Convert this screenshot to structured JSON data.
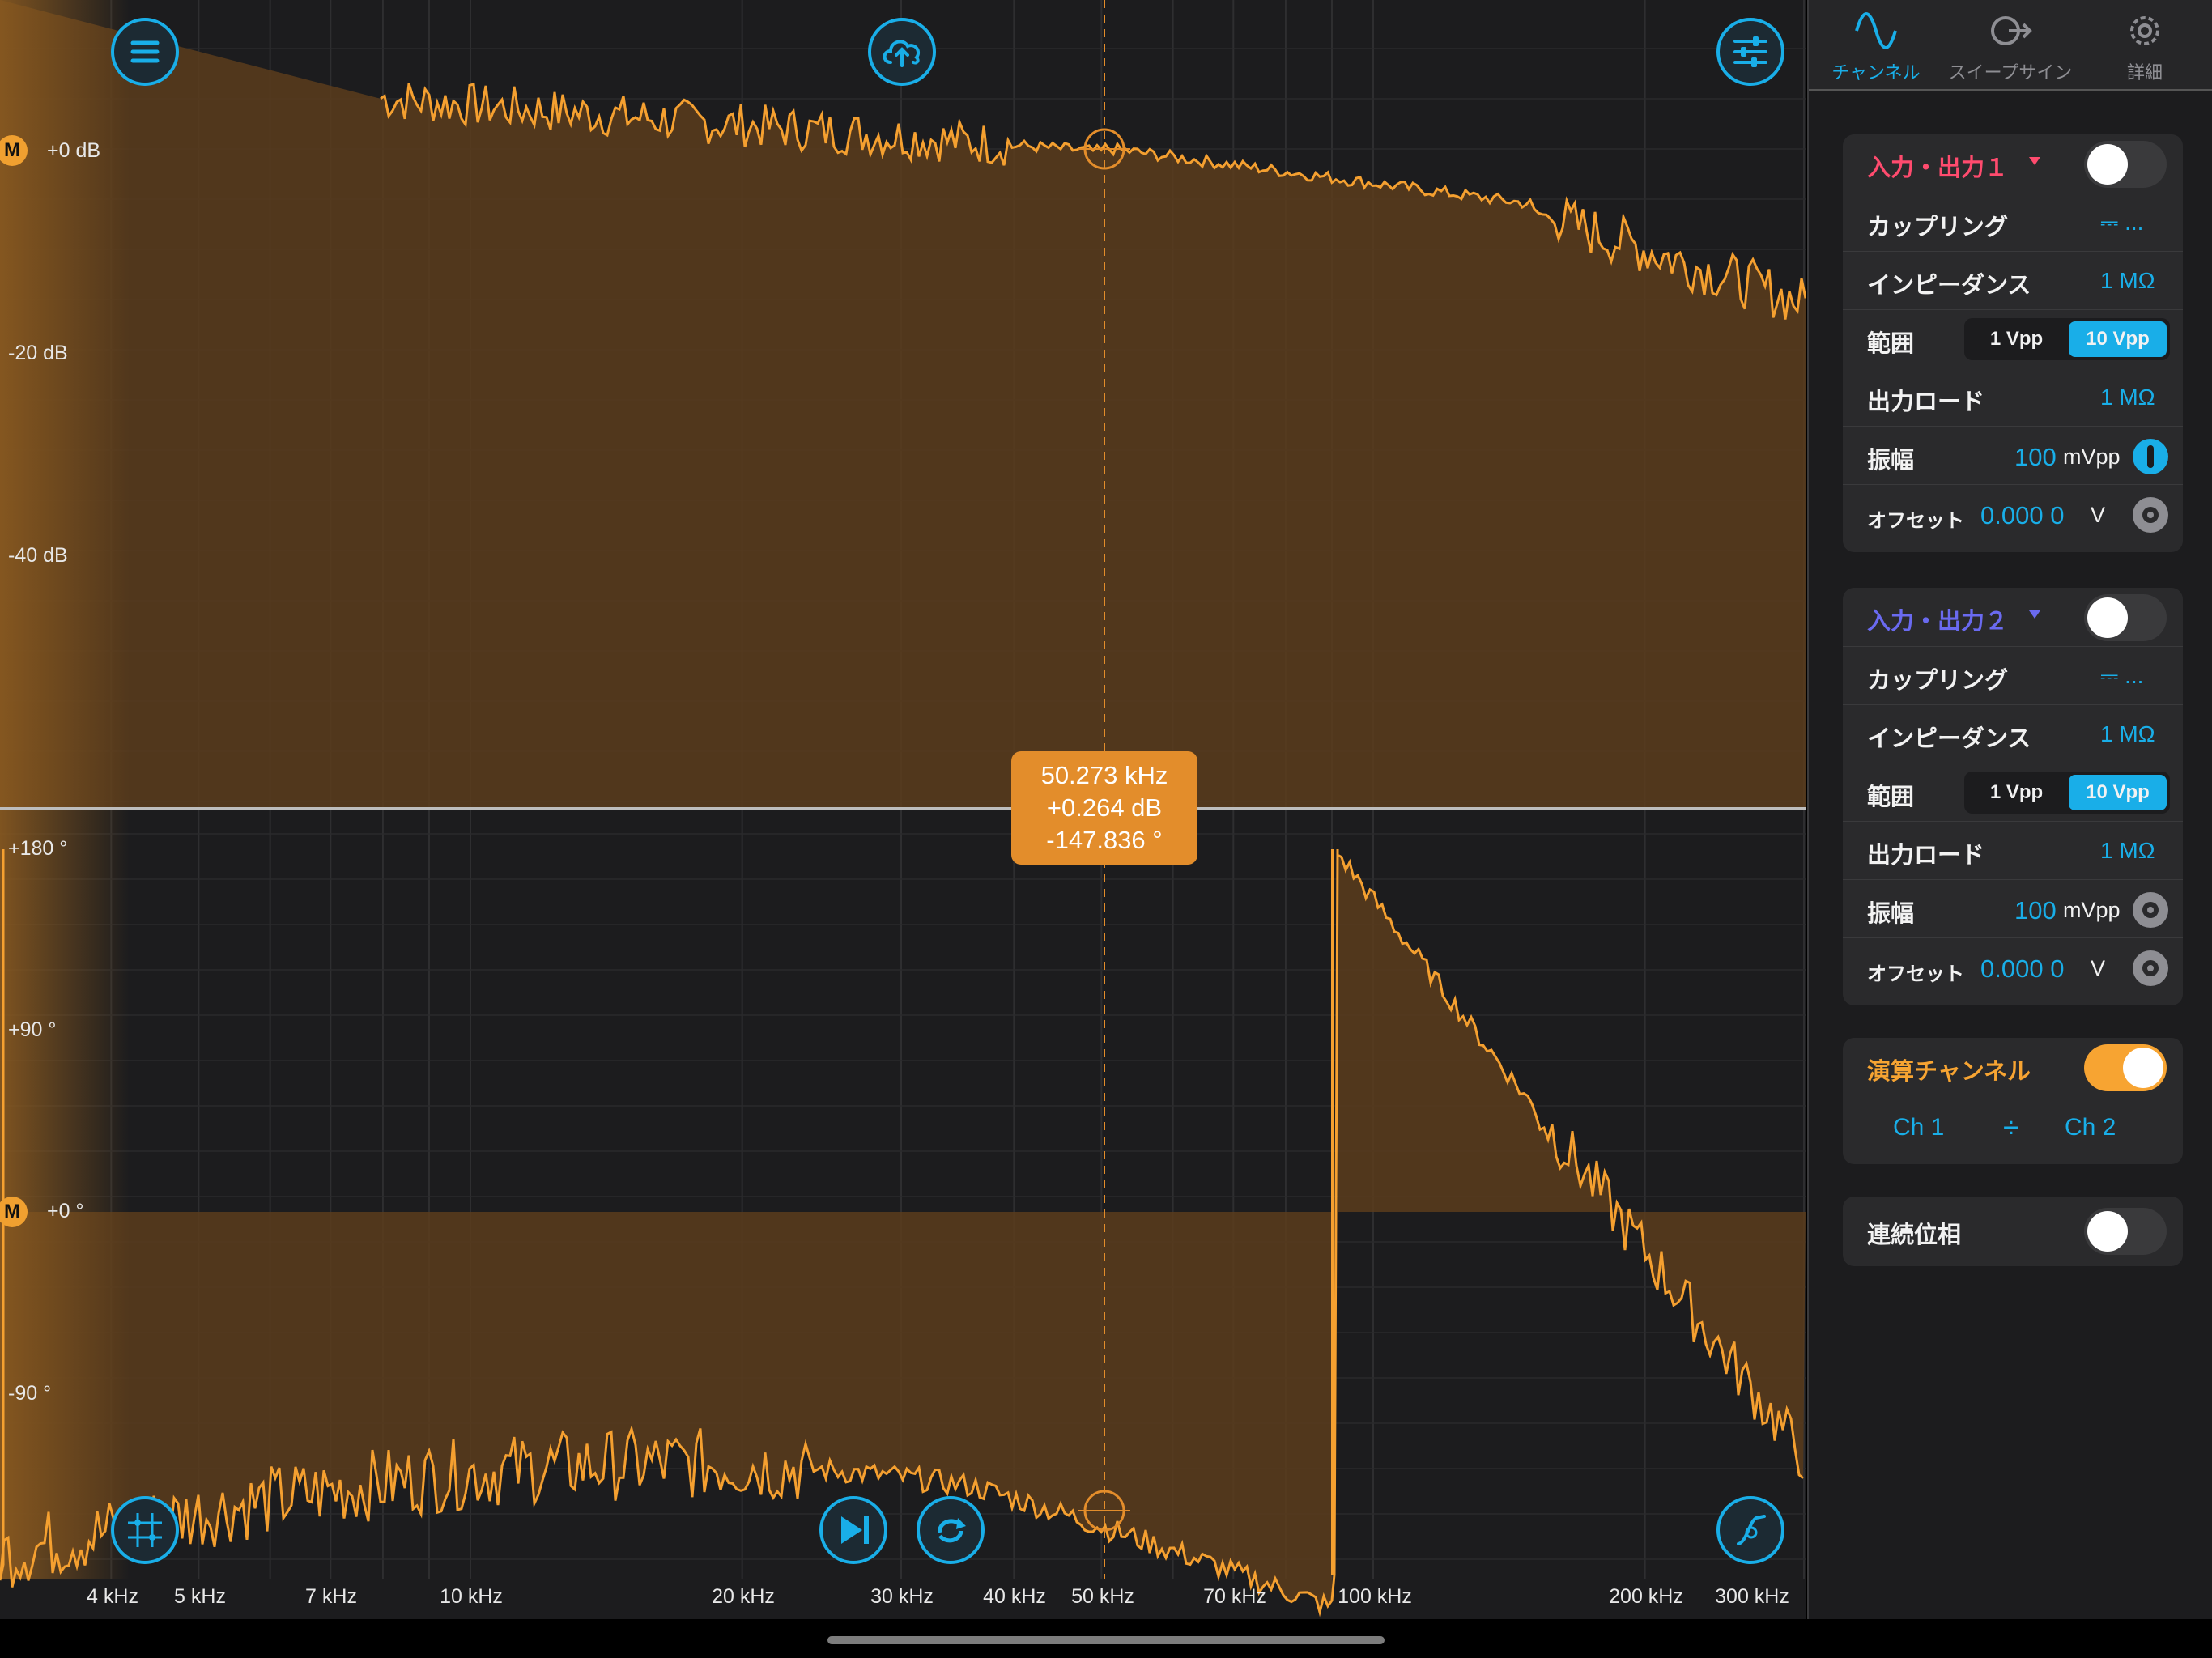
{
  "colors": {
    "accent": "#19aee8",
    "trace": "#f5a030",
    "fill": "#6b4620",
    "ch1": "#ff4b6e",
    "ch2": "#6a6af0",
    "math": "#f7a432"
  },
  "plot": {
    "magnitude_ticks": [
      "+0 dB",
      "-20 dB",
      "-40 dB"
    ],
    "phase_ticks": [
      "+180 °",
      "+90 °",
      "+0 °",
      "-90 °"
    ],
    "marker_label": "M",
    "freq_ticks": [
      "4 kHz",
      "5 kHz",
      "7 kHz",
      "10 kHz",
      "20 kHz",
      "30 kHz",
      "40 kHz",
      "50 kHz",
      "70 kHz",
      "100 kHz",
      "200 kHz",
      "300 kHz"
    ],
    "cursor": {
      "freq": "50.273 kHz",
      "gain": "+0.264 dB",
      "phase": "-147.836 °"
    }
  },
  "toolbar": {
    "menu_icon": "hamburger-menu-icon",
    "cloud_icon": "cloud-upload-icon",
    "settings_icon": "sliders-icon",
    "grid_icon": "grid-icon",
    "step_icon": "skip-forward-icon",
    "loop_icon": "repeat-icon",
    "trigger_icon": "trigger-icon"
  },
  "sidebar": {
    "tabs": [
      {
        "label": "チャンネル",
        "icon": "sine-wave-icon",
        "active": true
      },
      {
        "label": "スイープサイン",
        "icon": "sweep-icon",
        "active": false
      },
      {
        "label": "詳細",
        "icon": "gear-icon",
        "active": false
      }
    ],
    "ch1": {
      "title": "入力・出力１",
      "on": false,
      "coupling_label": "カップリング",
      "coupling_value": "⎓ ...",
      "impedance_label": "インピーダンス",
      "impedance_value": "1 MΩ",
      "range_label": "範囲",
      "range_options": [
        "1 Vpp",
        "10 Vpp"
      ],
      "range_selected": "10 Vpp",
      "load_label": "出力ロード",
      "load_value": "1 MΩ",
      "amp_label": "振幅",
      "amp_value": "100",
      "amp_unit": "mVpp",
      "offset_label": "オフセット",
      "offset_value": "0.000 0",
      "offset_unit": "V"
    },
    "ch2": {
      "title": "入力・出力２",
      "on": false,
      "coupling_label": "カップリング",
      "coupling_value": "⎓ ...",
      "impedance_label": "インピーダンス",
      "impedance_value": "1 MΩ",
      "range_label": "範囲",
      "range_options": [
        "1 Vpp",
        "10 Vpp"
      ],
      "range_selected": "10 Vpp",
      "load_label": "出力ロード",
      "load_value": "1 MΩ",
      "amp_label": "振幅",
      "amp_value": "100",
      "amp_unit": "mVpp",
      "offset_label": "オフセット",
      "offset_value": "0.000 0",
      "offset_unit": "V"
    },
    "math": {
      "title": "演算チャンネル",
      "on": true,
      "operand_a": "Ch 1",
      "operator": "÷",
      "operand_b": "Ch 2"
    },
    "continuous_phase": {
      "title": "連続位相",
      "on": false
    }
  }
}
